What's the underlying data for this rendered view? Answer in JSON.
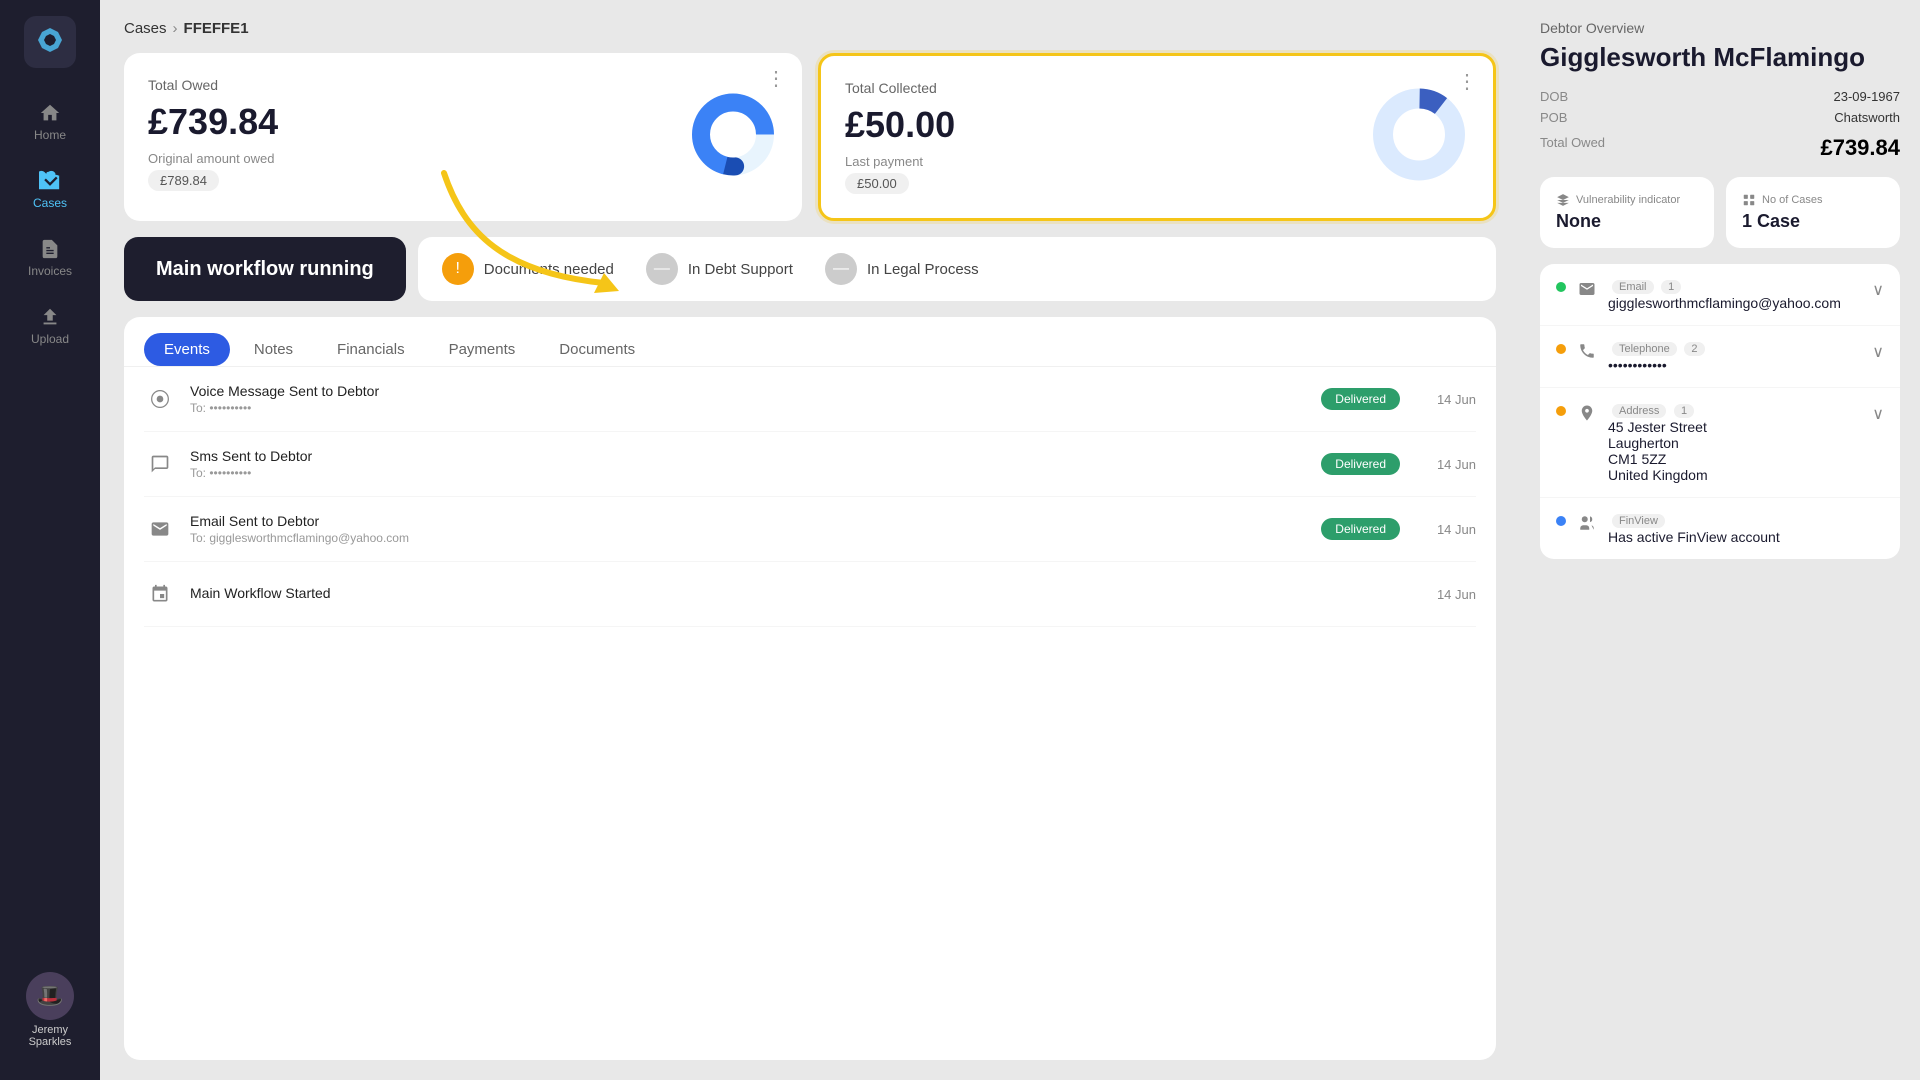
{
  "app": {
    "logo_icon": "diamond-icon"
  },
  "sidebar": {
    "items": [
      {
        "id": "home",
        "label": "Home",
        "icon": "home-icon",
        "active": false
      },
      {
        "id": "cases",
        "label": "Cases",
        "icon": "cases-icon",
        "active": true
      },
      {
        "id": "invoices",
        "label": "Invoices",
        "icon": "invoices-icon",
        "active": false
      },
      {
        "id": "upload",
        "label": "Upload",
        "icon": "upload-icon",
        "active": false
      }
    ],
    "user": {
      "name_line1": "Jeremy",
      "name_line2": "Sparkles"
    }
  },
  "breadcrumb": {
    "parent": "Cases",
    "current": "FFEFFE1"
  },
  "total_owed_card": {
    "title": "Total Owed",
    "amount": "£739.84",
    "sub_label": "Original amount owed",
    "sub_value": "£789.84"
  },
  "total_collected_card": {
    "title": "Total Collected",
    "amount": "£50.00",
    "last_payment_label": "Last payment",
    "last_payment_value": "£50.00"
  },
  "workflow": {
    "label": "Main workflow running"
  },
  "status_items": [
    {
      "id": "documents",
      "label": "Documents needed",
      "type": "warning"
    },
    {
      "id": "debt_support",
      "label": "In Debt Support",
      "type": "neutral"
    },
    {
      "id": "legal",
      "label": "In Legal Process",
      "type": "neutral"
    }
  ],
  "tabs": [
    {
      "id": "events",
      "label": "Events",
      "active": true
    },
    {
      "id": "notes",
      "label": "Notes",
      "active": false
    },
    {
      "id": "financials",
      "label": "Financials",
      "active": false
    },
    {
      "id": "payments",
      "label": "Payments",
      "active": false
    },
    {
      "id": "documents",
      "label": "Documents",
      "active": false
    }
  ],
  "events": [
    {
      "icon": "location-icon",
      "title": "Voice Message Sent to Debtor",
      "sub": "To: ••••••••••",
      "badge": "Delivered",
      "date": "14 Jun"
    },
    {
      "icon": "chat-icon",
      "title": "Sms Sent to Debtor",
      "sub": "To: ••••••••••",
      "badge": "Delivered",
      "date": "14 Jun"
    },
    {
      "icon": "email-icon",
      "title": "Email Sent to Debtor",
      "sub": "To: gigglesworthmcflamingo@yahoo.com",
      "badge": "Delivered",
      "date": "14 Jun"
    },
    {
      "icon": "workflow-icon",
      "title": "Main Workflow Started",
      "sub": "",
      "badge": "",
      "date": "14 Jun"
    }
  ],
  "debtor": {
    "header": "Debtor Overview",
    "name": "Gigglesworth McFlamingo",
    "dob_label": "DOB",
    "dob_value": "23-09-1967",
    "pob_label": "POB",
    "pob_value": "Chatsworth",
    "total_owed_label": "Total Owed",
    "total_owed_value": "£739.84"
  },
  "vulnerability": {
    "label": "Vulnerability indicator",
    "value": "None"
  },
  "no_of_cases": {
    "label": "No of Cases",
    "value": "1 Case"
  },
  "contacts": [
    {
      "type": "Email",
      "count": "1",
      "value": "gigglesworthmcflamingo@yahoo.com",
      "dot_color": "green",
      "icon": "email-icon",
      "expandable": true
    },
    {
      "type": "Telephone",
      "count": "2",
      "value": "••••••••••••",
      "dot_color": "yellow",
      "icon": "phone-icon",
      "expandable": true
    },
    {
      "type": "Address",
      "count": "1",
      "value": "45 Jester Street\nLaugherton\nCM1 5ZZ\nUnited Kingdom",
      "dot_color": "yellow",
      "icon": "location-icon",
      "expandable": true
    },
    {
      "type": "FinView",
      "count": "",
      "value": "Has active FinView account",
      "dot_color": "blue",
      "icon": "finview-icon",
      "expandable": false
    }
  ],
  "donut": {
    "total": 789.84,
    "collected": 50,
    "remaining": 739.84
  }
}
